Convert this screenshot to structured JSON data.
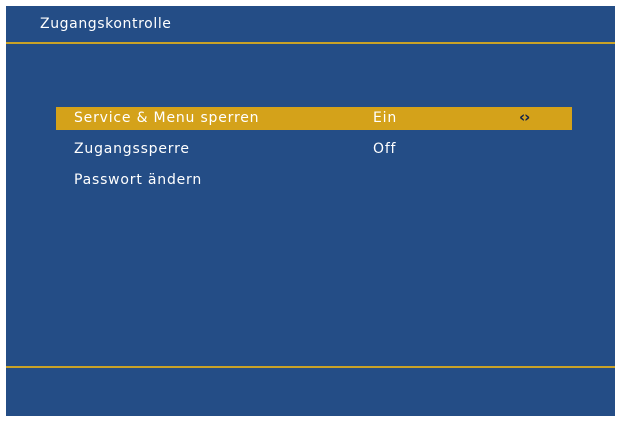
{
  "header": {
    "title": "Zugangskontrolle"
  },
  "menu": {
    "items": [
      {
        "label": "Service & Menu sperren",
        "value": "Ein",
        "selected": true,
        "icon": "left-right-arrows-icon",
        "arrows": "‹›"
      },
      {
        "label": "Zugangssperre",
        "value": "Off",
        "selected": false
      },
      {
        "label": "Passwort ändern",
        "value": "",
        "selected": false
      }
    ]
  },
  "colors": {
    "background": "#244d86",
    "highlight": "#d4a21a",
    "divider": "#c9a227",
    "text": "#ffffff"
  }
}
